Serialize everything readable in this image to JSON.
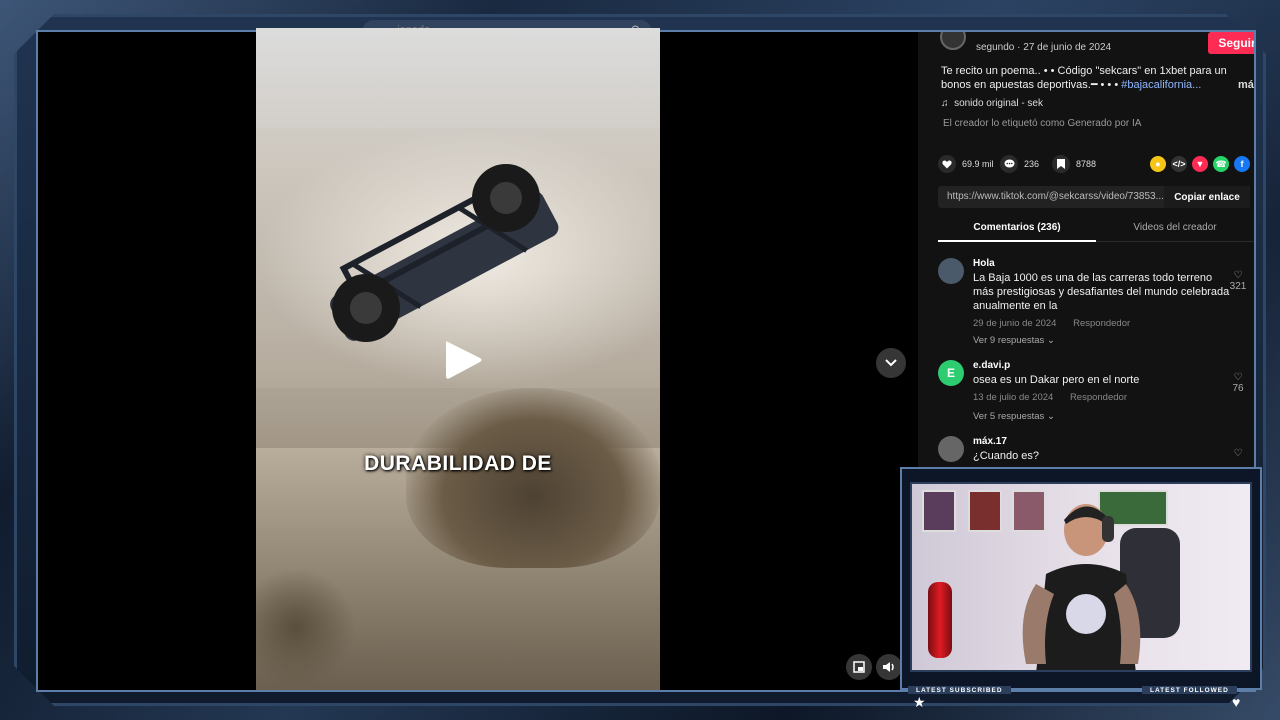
{
  "video": {
    "search_placeholder": "...ionado",
    "caption": "DURABILIDAD DE"
  },
  "post": {
    "author_meta": "segundo · 27 de junio de 2024",
    "follow_label": "Seguir",
    "description_line1": "Te recito un poema.. • • Código \"sekcars\" en 1xbet para un",
    "description_line2_prefix": "bonos en apuestas deportivas.━ • • • ",
    "description_hashtag": "#bajacalifornia...",
    "more_label": "más",
    "sound": "sonido original - sek",
    "ai_label": "El creador lo etiquetó como Generado por IA",
    "likes": "69.9 mil",
    "comments": "236",
    "saves": "8788",
    "url": "https://www.tiktok.com/@sekcarss/video/73853...",
    "copy_label": "Copiar enlace"
  },
  "tabs": [
    {
      "label": "Comentarios (236)",
      "active": true
    },
    {
      "label": "Videos del creador",
      "active": false
    }
  ],
  "comments": [
    {
      "user": "Hola",
      "text": "La Baja 1000 es una de las carreras todo terreno más prestigiosas y desafiantes del mundo celebrada anualmente en la",
      "date": "29 de junio de 2024",
      "reply_label": "Respondedor",
      "replies": "Ver 9 respuestas",
      "likes": "321",
      "avatar_color": "#4a5a6a"
    },
    {
      "user": "e.davi.p",
      "text": "osea es un Dakar pero en el norte",
      "date": "13 de julio de 2024",
      "reply_label": "Respondedor",
      "replies": "Ver 5 respuestas",
      "likes": "76",
      "avatar_color": "#2ecc71",
      "avatar_letter": "E"
    },
    {
      "user": "máx.17",
      "text": "¿Cuando es?",
      "avatar_color": "#666"
    }
  ],
  "stream": {
    "latest_subscriber_label": "LATEST SUBSCRIBED",
    "latest_follower_label": "LATEST FOLLOWED"
  },
  "colors": {
    "accent_pink": "#fe2c55",
    "frame_blue": "#5d7ea8",
    "panel_bg": "#121212"
  }
}
